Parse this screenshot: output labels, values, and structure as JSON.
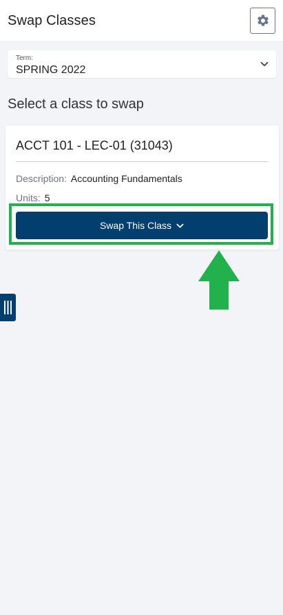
{
  "header": {
    "title": "Swap Classes",
    "settings_icon": "gear-icon"
  },
  "term": {
    "label": "Term:",
    "value": "SPRING 2022",
    "icon": "chevron-down-icon"
  },
  "section_heading": "Select a class to swap",
  "class_card": {
    "title": "ACCT 101 - LEC-01 (31043)",
    "description_label": "Description:",
    "description_value": "Accounting Fundamentals",
    "units_label": "Units:",
    "units_value": "5",
    "swap_button_label": "Swap This Class",
    "swap_button_icon": "chevron-down-icon"
  },
  "side_tab": {
    "icon": "menu-bars-icon"
  },
  "colors": {
    "primary": "#023f6e",
    "highlight": "#22b14c",
    "background": "#f3f4f8"
  }
}
